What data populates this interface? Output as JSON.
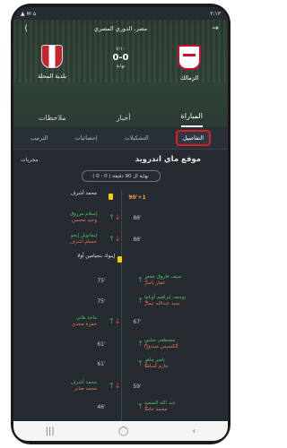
{
  "status": {
    "time": "٢:١٣",
    "icons_left": "▲ ✉ ⌂",
    "icons_right": "✈ ◧ ▦"
  },
  "header": {
    "league": "مصر، الدوري المصري",
    "home_team": "الزمالك",
    "away_team": "بلدية المحلة",
    "round": "٧/١٠",
    "score": "0-0",
    "state": "نهاية"
  },
  "tabs": [
    {
      "label": "المباراة",
      "active": true
    },
    {
      "label": "أخبار",
      "active": false
    },
    {
      "label": "ملاحظات",
      "active": false
    }
  ],
  "subtabs": [
    {
      "label": "التفاصيل",
      "active": true
    },
    {
      "label": "التشكيلات",
      "active": false
    },
    {
      "label": "إحصائيات",
      "active": false
    },
    {
      "label": "الترتيب",
      "active": false
    }
  ],
  "content": {
    "title": "موقع ماي اندرويد",
    "more": "مجريات",
    "period_pill": "نهاية ال 90 دقيقة ( 0 - 0 )"
  },
  "events": [
    {
      "minute": "90'+1",
      "type": "goal-card",
      "side": "left",
      "names": [
        "محمد أشرف"
      ],
      "classes": [
        "n-plain"
      ]
    },
    {
      "minute": "88'",
      "type": "sub",
      "side": "left",
      "names": [
        "إسلام مرزوق",
        "وحيد محسن"
      ],
      "classes": [
        "n-in",
        "n-out"
      ]
    },
    {
      "minute": "88'",
      "type": "sub",
      "side": "left",
      "names": [
        "إيمانويل إيجو",
        "حسام أشرف"
      ],
      "classes": [
        "n-in",
        "n-out"
      ]
    },
    {
      "minute": "",
      "type": "card",
      "side": "left",
      "names": [
        "إيبوك بنجيامين أولا"
      ],
      "classes": [
        "n-plain"
      ]
    },
    {
      "minute": "75'",
      "type": "sub",
      "side": "right",
      "names": [
        "سيف فاروق جعفر",
        "عمار ياسر"
      ],
      "classes": [
        "n-in",
        "n-out"
      ]
    },
    {
      "minute": "75'",
      "type": "sub",
      "side": "right",
      "names": [
        "يوسف إبراهيم أوباما",
        "سيد عبدالله نيمار"
      ],
      "classes": [
        "n-in",
        "n-out"
      ]
    },
    {
      "minute": "67'",
      "type": "sub",
      "side": "left",
      "names": [
        "ماجد هاني",
        "حمزة مجدي"
      ],
      "classes": [
        "n-in",
        "n-out"
      ]
    },
    {
      "minute": "61'",
      "type": "sub",
      "side": "right",
      "names": [
        "مصطفى شلبي",
        "ألكسيس ميندوزا"
      ],
      "classes": [
        "n-in",
        "n-out"
      ]
    },
    {
      "minute": "61'",
      "type": "sub",
      "side": "right",
      "names": [
        "ناصر ماهر",
        "حازم أسامة"
      ],
      "classes": [
        "n-in",
        "n-out"
      ]
    },
    {
      "minute": "59'",
      "type": "sub",
      "side": "left",
      "names": [
        "محمد أشرف",
        "محمد صابر"
      ],
      "classes": [
        "n-in",
        "n-out"
      ]
    },
    {
      "minute": "46'",
      "type": "sub",
      "side": "right",
      "names": [
        "عبد الله السعيد",
        "محمد حامد"
      ],
      "classes": [
        "n-in",
        "n-out"
      ]
    }
  ],
  "navbar": {
    "recent": "|||",
    "home": "◯",
    "back": "‹"
  },
  "colors": {
    "accent": "#d61f26",
    "sub_in": "#4fbf66",
    "sub_out": "#e07b52",
    "card": "#f5d000",
    "goal": "#f0a53a"
  }
}
